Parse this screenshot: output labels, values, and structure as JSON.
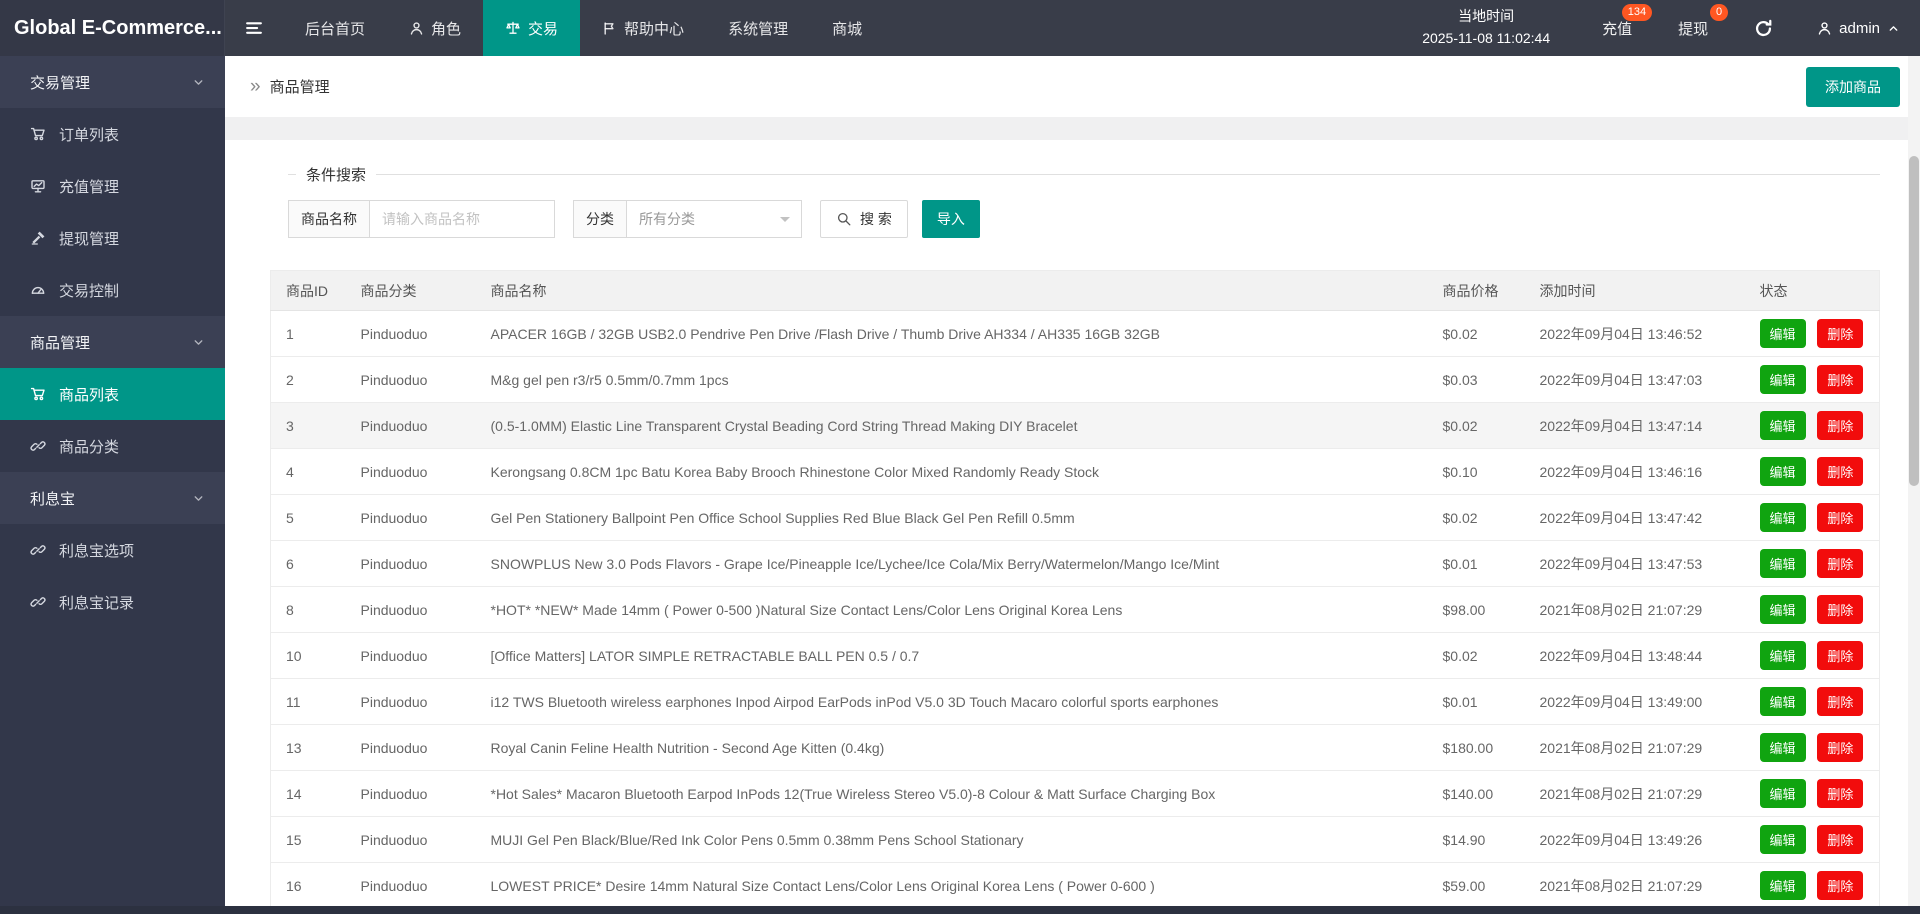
{
  "navbar": {
    "logo": "Global E-Commerce...",
    "items": [
      {
        "label": "后台首页"
      },
      {
        "label": "角色",
        "icon": "user-icon"
      },
      {
        "label": "交易",
        "icon": "scales-icon",
        "active": true
      },
      {
        "label": "帮助中心",
        "icon": "flag-icon"
      },
      {
        "label": "系统管理"
      },
      {
        "label": "商城"
      }
    ],
    "local_time_label": "当地时间",
    "local_time_value": "2025-11-08 11:02:44",
    "recharge_label": "充值",
    "recharge_badge": "134",
    "withdraw_label": "提现",
    "withdraw_badge": "0",
    "username": "admin"
  },
  "sidebar": {
    "items": [
      {
        "label": "交易管理",
        "type": "section",
        "icon": "chevron-down-icon"
      },
      {
        "label": "订单列表",
        "icon": "cart-icon"
      },
      {
        "label": "充值管理",
        "icon": "chart-board-icon"
      },
      {
        "label": "提现管理",
        "icon": "gavel-icon"
      },
      {
        "label": "交易控制",
        "icon": "gauge-icon"
      },
      {
        "label": "商品管理",
        "type": "section",
        "icon": "chevron-down-icon"
      },
      {
        "label": "商品列表",
        "icon": "cart-icon",
        "active": true
      },
      {
        "label": "商品分类",
        "icon": "link-icon"
      },
      {
        "label": "利息宝",
        "type": "section",
        "icon": "chevron-down-icon"
      },
      {
        "label": "利息宝选项",
        "icon": "link-icon"
      },
      {
        "label": "利息宝记录",
        "icon": "link-icon"
      }
    ]
  },
  "breadcrumb": {
    "icon": "double-arrow-icon",
    "title": "商品管理"
  },
  "toolbar": {
    "add_label": "添加商品"
  },
  "search": {
    "legend": "条件搜索",
    "name_label": "商品名称",
    "name_placeholder": "请输入商品名称",
    "category_label": "分类",
    "category_value": "所有分类",
    "search_label": "搜 索",
    "import_label": "导入"
  },
  "table": {
    "headers": [
      "商品ID",
      "商品分类",
      "商品名称",
      "商品价格",
      "添加时间",
      "状态"
    ],
    "edit_label": "编辑",
    "delete_label": "删除",
    "rows": [
      {
        "id": "1",
        "category": "Pinduoduo",
        "name": "APACER 16GB / 32GB USB2.0 Pendrive Pen Drive /Flash Drive / Thumb Drive AH334 / AH335 16GB 32GB",
        "price": "$0.02",
        "time": "2022年09月04日 13:46:52"
      },
      {
        "id": "2",
        "category": "Pinduoduo",
        "name": "M&g gel pen r3/r5 0.5mm/0.7mm 1pcs",
        "price": "$0.03",
        "time": "2022年09月04日 13:47:03"
      },
      {
        "id": "3",
        "category": "Pinduoduo",
        "name": "(0.5-1.0MM) Elastic Line Transparent Crystal Beading Cord String Thread Making DIY Bracelet",
        "price": "$0.02",
        "time": "2022年09月04日 13:47:14",
        "highlight": true
      },
      {
        "id": "4",
        "category": "Pinduoduo",
        "name": "Kerongsang 0.8CM 1pc Batu Korea Baby Brooch Rhinestone Color Mixed Randomly Ready Stock",
        "price": "$0.10",
        "time": "2022年09月04日 13:46:16"
      },
      {
        "id": "5",
        "category": "Pinduoduo",
        "name": "Gel Pen Stationery Ballpoint Pen Office School Supplies Red Blue Black Gel Pen Refill 0.5mm",
        "price": "$0.02",
        "time": "2022年09月04日 13:47:42"
      },
      {
        "id": "6",
        "category": "Pinduoduo",
        "name": "SNOWPLUS New 3.0 Pods Flavors - Grape Ice/Pineapple Ice/Lychee/Ice Cola/Mix Berry/Watermelon/Mango Ice/Mint",
        "price": "$0.01",
        "time": "2022年09月04日 13:47:53"
      },
      {
        "id": "8",
        "category": "Pinduoduo",
        "name": "*HOT* *NEW* Made 14mm ( Power 0-500 )Natural Size Contact Lens/Color Lens Original Korea Lens",
        "price": "$98.00",
        "time": "2021年08月02日 21:07:29"
      },
      {
        "id": "10",
        "category": "Pinduoduo",
        "name": "[Office Matters] LATOR SIMPLE RETRACTABLE BALL PEN 0.5 / 0.7",
        "price": "$0.02",
        "time": "2022年09月04日 13:48:44"
      },
      {
        "id": "11",
        "category": "Pinduoduo",
        "name": "i12 TWS Bluetooth wireless earphones Inpod Airpod EarPods inPod V5.0 3D Touch Macaro colorful sports earphones",
        "price": "$0.01",
        "time": "2022年09月04日 13:49:00"
      },
      {
        "id": "13",
        "category": "Pinduoduo",
        "name": "Royal Canin Feline Health Nutrition - Second Age Kitten (0.4kg)",
        "price": "$180.00",
        "time": "2021年08月02日 21:07:29"
      },
      {
        "id": "14",
        "category": "Pinduoduo",
        "name": "*Hot Sales* Macaron Bluetooth Earpod InPods 12(True Wireless Stereo V5.0)-8 Colour & Matt Surface Charging Box",
        "price": "$140.00",
        "time": "2021年08月02日 21:07:29"
      },
      {
        "id": "15",
        "category": "Pinduoduo",
        "name": "MUJI Gel Pen Black/Blue/Red Ink Color Pens 0.5mm 0.38mm Pens School Stationary",
        "price": "$14.90",
        "time": "2022年09月04日 13:49:26"
      },
      {
        "id": "16",
        "category": "Pinduoduo",
        "name": "LOWEST PRICE* Desire 14mm Natural Size Contact Lens/Color Lens Original Korea Lens ( Power 0-600 )",
        "price": "$59.00",
        "time": "2021年08月02日 21:07:29"
      }
    ]
  },
  "colors": {
    "accent_teal": "#009688",
    "navbar_bg": "#393d49",
    "sidebar_bg": "#32374a",
    "badge_orange": "#FF5722",
    "edit_green": "#10a410",
    "delete_red": "#f20c0c"
  }
}
